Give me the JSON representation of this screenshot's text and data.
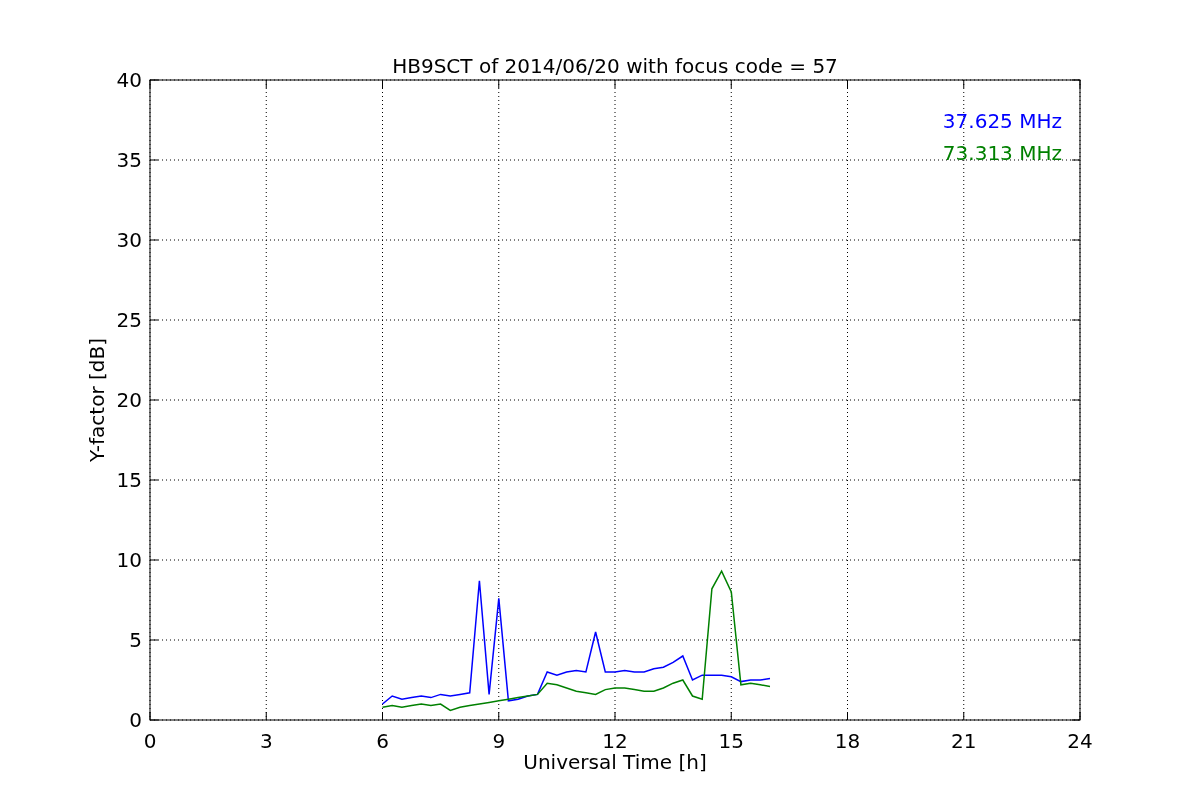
{
  "chart_data": {
    "type": "line",
    "title": "HB9SCT of 2014/06/20 with focus code = 57",
    "xlabel": "Universal Time [h]",
    "ylabel": "Y-factor [dB]",
    "x": [
      6,
      6.25,
      6.5,
      6.75,
      7,
      7.25,
      7.5,
      7.75,
      8,
      8.25,
      8.5,
      8.75,
      9,
      9.25,
      9.5,
      9.75,
      10,
      10.25,
      10.5,
      10.75,
      11,
      11.25,
      11.5,
      11.75,
      12,
      12.25,
      12.5,
      12.75,
      13,
      13.25,
      13.5,
      13.75,
      14,
      14.25,
      14.5,
      14.75,
      15,
      15.25,
      15.5,
      15.75,
      16
    ],
    "series": [
      {
        "name": "37.625 MHz",
        "color": "#0000ff",
        "values": [
          1.0,
          1.5,
          1.3,
          1.4,
          1.5,
          1.4,
          1.6,
          1.5,
          1.6,
          1.7,
          8.7,
          1.6,
          7.6,
          1.2,
          1.3,
          1.5,
          1.6,
          3.0,
          2.8,
          3.0,
          3.1,
          3.0,
          5.5,
          3.0,
          3.0,
          3.1,
          3.0,
          3.0,
          3.2,
          3.3,
          3.6,
          4.0,
          2.5,
          2.8,
          2.8,
          2.8,
          2.7,
          2.4,
          2.5,
          2.5,
          2.6
        ]
      },
      {
        "name": "73.313 MHz",
        "color": "#008000",
        "values": [
          0.8,
          0.9,
          0.8,
          0.9,
          1.0,
          0.9,
          1.0,
          0.6,
          0.8,
          0.9,
          1.0,
          1.1,
          1.2,
          1.3,
          1.4,
          1.5,
          1.6,
          2.3,
          2.2,
          2.0,
          1.8,
          1.7,
          1.6,
          1.9,
          2.0,
          2.0,
          1.9,
          1.8,
          1.8,
          2.0,
          2.3,
          2.5,
          1.5,
          1.3,
          8.2,
          9.3,
          8.0,
          2.2,
          2.3,
          2.2,
          2.1
        ]
      }
    ],
    "xlim": [
      0,
      24
    ],
    "ylim": [
      0,
      40
    ],
    "xticks": [
      0,
      3,
      6,
      9,
      12,
      15,
      18,
      21,
      24
    ],
    "yticks": [
      0,
      5,
      10,
      15,
      20,
      25,
      30,
      35,
      40
    ],
    "grid": true
  }
}
